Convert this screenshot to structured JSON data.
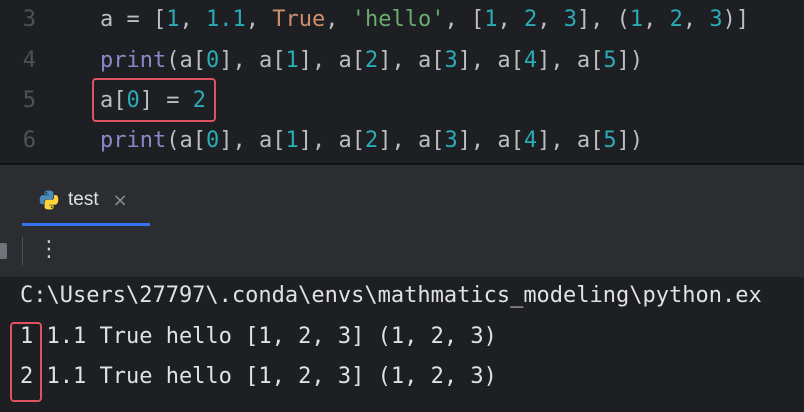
{
  "editor": {
    "lines": [
      {
        "number": "3",
        "tokens": [
          {
            "t": "a = [",
            "c": "plain"
          },
          {
            "t": "1",
            "c": "number"
          },
          {
            "t": ", ",
            "c": "plain"
          },
          {
            "t": "1.1",
            "c": "number"
          },
          {
            "t": ", ",
            "c": "plain"
          },
          {
            "t": "True",
            "c": "keyword"
          },
          {
            "t": ", ",
            "c": "plain"
          },
          {
            "t": "'hello'",
            "c": "string"
          },
          {
            "t": ", [",
            "c": "plain"
          },
          {
            "t": "1",
            "c": "number"
          },
          {
            "t": ", ",
            "c": "plain"
          },
          {
            "t": "2",
            "c": "number"
          },
          {
            "t": ", ",
            "c": "plain"
          },
          {
            "t": "3",
            "c": "number"
          },
          {
            "t": "], (",
            "c": "plain"
          },
          {
            "t": "1",
            "c": "number"
          },
          {
            "t": ", ",
            "c": "plain"
          },
          {
            "t": "2",
            "c": "number"
          },
          {
            "t": ", ",
            "c": "plain"
          },
          {
            "t": "3",
            "c": "number"
          },
          {
            "t": ")]",
            "c": "plain"
          }
        ]
      },
      {
        "number": "4",
        "tokens": [
          {
            "t": "print",
            "c": "builtin"
          },
          {
            "t": "(a[",
            "c": "plain"
          },
          {
            "t": "0",
            "c": "number"
          },
          {
            "t": "], a[",
            "c": "plain"
          },
          {
            "t": "1",
            "c": "number"
          },
          {
            "t": "], a[",
            "c": "plain"
          },
          {
            "t": "2",
            "c": "number"
          },
          {
            "t": "], a[",
            "c": "plain"
          },
          {
            "t": "3",
            "c": "number"
          },
          {
            "t": "], a[",
            "c": "plain"
          },
          {
            "t": "4",
            "c": "number"
          },
          {
            "t": "], a[",
            "c": "plain"
          },
          {
            "t": "5",
            "c": "number"
          },
          {
            "t": "])",
            "c": "plain"
          }
        ]
      },
      {
        "number": "5",
        "tokens": [
          {
            "t": "a[",
            "c": "plain"
          },
          {
            "t": "0",
            "c": "number"
          },
          {
            "t": "] = ",
            "c": "plain"
          },
          {
            "t": "2",
            "c": "number"
          }
        ]
      },
      {
        "number": "6",
        "tokens": [
          {
            "t": "print",
            "c": "builtin"
          },
          {
            "t": "(a[",
            "c": "plain"
          },
          {
            "t": "0",
            "c": "number"
          },
          {
            "t": "], a[",
            "c": "plain"
          },
          {
            "t": "1",
            "c": "number"
          },
          {
            "t": "], a[",
            "c": "plain"
          },
          {
            "t": "2",
            "c": "number"
          },
          {
            "t": "], a[",
            "c": "plain"
          },
          {
            "t": "3",
            "c": "number"
          },
          {
            "t": "], a[",
            "c": "plain"
          },
          {
            "t": "4",
            "c": "number"
          },
          {
            "t": "], a[",
            "c": "plain"
          },
          {
            "t": "5",
            "c": "number"
          },
          {
            "t": "])",
            "c": "plain"
          }
        ]
      }
    ]
  },
  "run_panel": {
    "tab": {
      "label": "test",
      "icon": "python-icon",
      "close_icon": "close-icon",
      "close_glyph": "×"
    },
    "toolbar": {
      "more_icon": "more-vertical-icon",
      "more_glyph": "⋮"
    },
    "console": {
      "lines": [
        "C:\\Users\\27797\\.conda\\envs\\mathmatics_modeling\\python.ex",
        "1 1.1 True hello [1, 2, 3] (1, 2, 3)",
        "2 1.1 True hello [1, 2, 3] (1, 2, 3)"
      ]
    }
  },
  "colors": {
    "editor_bg": "#1e1f22",
    "panel_bg": "#2b2d30",
    "highlight": "#e0525f",
    "number": "#2aacb8",
    "keyword": "#cf8e6d",
    "string": "#6aab73",
    "builtin": "#8888c6"
  }
}
